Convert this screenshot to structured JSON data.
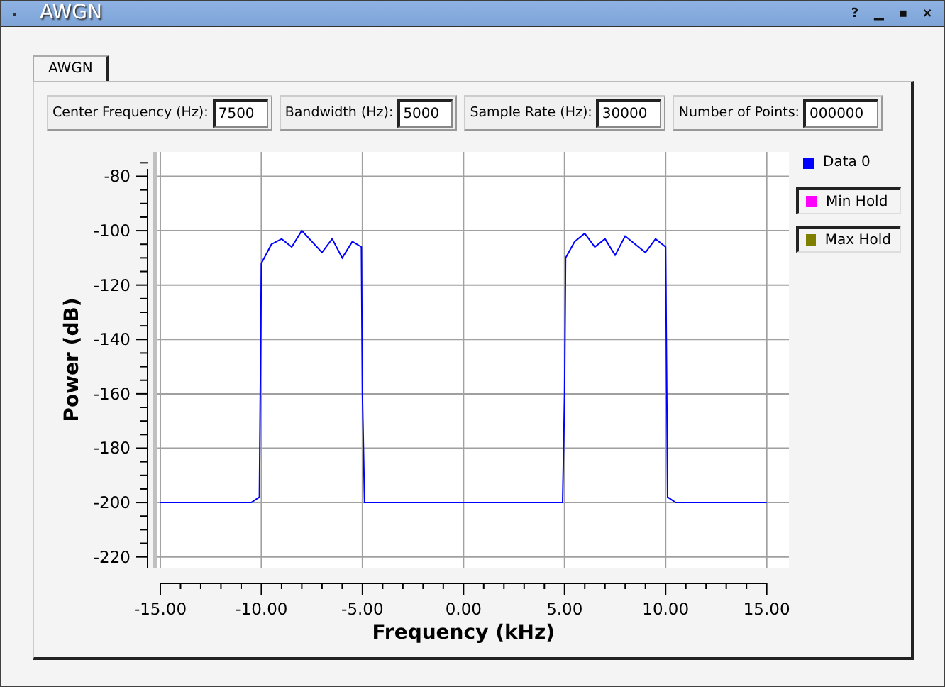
{
  "window": {
    "title": "AWGN",
    "controls": [
      "?",
      "▁",
      "▪",
      "×"
    ]
  },
  "tabs": [
    {
      "label": "AWGN",
      "selected": true
    }
  ],
  "parameters": [
    {
      "label": "Center Frequency (Hz):",
      "value": "7500"
    },
    {
      "label": "Bandwidth (Hz):",
      "value": "5000"
    },
    {
      "label": "Sample Rate (Hz):",
      "value": "30000"
    },
    {
      "label": "Number of Points:",
      "value": "000000"
    }
  ],
  "legend": [
    {
      "kind": "toggle",
      "name": "Min Hold",
      "color": "#ff00ff"
    },
    {
      "kind": "toggle",
      "name": "Max Hold",
      "color": "#808000"
    }
  ],
  "plot": {
    "chart_data": {
      "type": "line",
      "grid": true,
      "xlabel": "Frequency (kHz)",
      "ylabel": "Power (dB)",
      "xlim": [
        -15.35,
        16.1
      ],
      "ylim": [
        -224,
        -71
      ],
      "xticks": [
        {
          "value": -15,
          "label": "-15.00"
        },
        {
          "value": -10,
          "label": "-10.00"
        },
        {
          "value": -5,
          "label": "-5.00"
        },
        {
          "value": 0,
          "label": "0.00"
        },
        {
          "value": 5,
          "label": "5.00"
        },
        {
          "value": 10,
          "label": "10.00"
        },
        {
          "value": 15,
          "label": "15.00"
        }
      ],
      "yticks": [
        -80,
        -100,
        -120,
        -140,
        -160,
        -180,
        -200,
        -220
      ],
      "x": [
        -15,
        -10.5,
        -10.1,
        -10,
        -9.5,
        -9,
        -8.5,
        -8,
        -7.5,
        -7,
        -6.5,
        -6,
        -5.5,
        -5.05,
        -5,
        -4.9,
        0,
        4.9,
        5,
        5.05,
        5.5,
        6,
        6.5,
        7,
        7.5,
        8,
        8.5,
        9,
        9.5,
        10,
        10.1,
        10.5,
        15
      ],
      "series": [
        {
          "name": "Data 0",
          "color": "#0000ff",
          "values": [
            -200,
            -200,
            -198,
            -112,
            -105,
            -103,
            -106,
            -100,
            -104,
            -108,
            -103,
            -110,
            -104,
            -106,
            -160,
            -200,
            -200,
            -200,
            -160,
            -110,
            -104,
            -101,
            -106,
            -103,
            -109,
            -102,
            -105,
            -108,
            -103,
            -106,
            -198,
            -200,
            -200
          ]
        }
      ]
    }
  }
}
